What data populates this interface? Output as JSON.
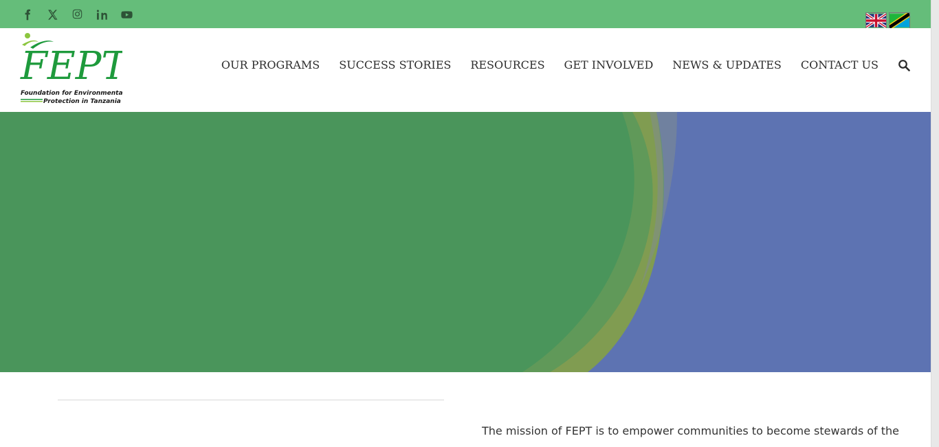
{
  "topbar": {
    "social": [
      {
        "name": "facebook-icon"
      },
      {
        "name": "x-twitter-icon"
      },
      {
        "name": "instagram-icon"
      },
      {
        "name": "linkedin-icon"
      },
      {
        "name": "youtube-icon"
      }
    ],
    "languages": [
      "english-flag-icon",
      "swahili-flag-icon"
    ]
  },
  "logo": {
    "wordmark": "FEPT",
    "line1": "Foundation for Environmental",
    "line2": "Protection in Tanzania"
  },
  "nav": {
    "items": [
      "OUR PROGRAMS",
      "SUCCESS STORIES",
      "RESOURCES",
      "GET INVOLVED",
      "NEWS & UPDATES",
      "CONTACT US"
    ]
  },
  "content": {
    "mission": "The mission of FEPT is to empower communities to become stewards of the"
  },
  "colors": {
    "topbar": "#65bd7a",
    "hero_green": "#4a955b",
    "hero_blue": "#5d73b2",
    "hero_olive": "#8a9e50",
    "logo_green": "#1e9a3c"
  }
}
